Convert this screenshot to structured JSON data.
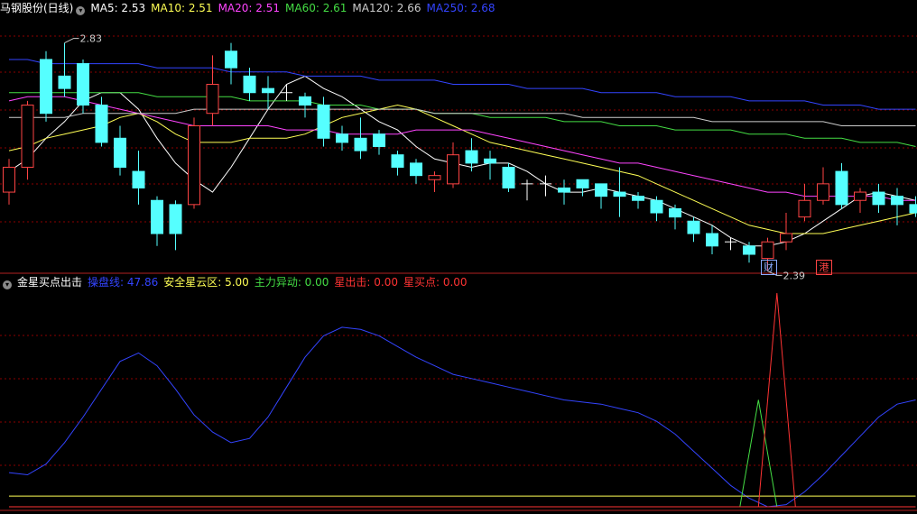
{
  "main_panel": {
    "title": "马钢股份(日线)",
    "indicators": [
      {
        "label": "MA5: 2.53",
        "color": "#ffffff"
      },
      {
        "label": "MA10: 2.51",
        "color": "#ffff55"
      },
      {
        "label": "MA20: 2.51",
        "color": "#ff44ff"
      },
      {
        "label": "MA60: 2.61",
        "color": "#44dd44"
      },
      {
        "label": "MA120: 2.66",
        "color": "#cccccc"
      },
      {
        "label": "MA250: 2.68",
        "color": "#3344ff"
      }
    ],
    "high_marker": "2.83",
    "low_marker": "2.39",
    "events": [
      {
        "label": "财",
        "color": "#88aaff",
        "index": 41
      },
      {
        "label": "港",
        "color": "#ff4444",
        "index": 44
      }
    ]
  },
  "indicator_panel": {
    "title": "金星买点出击",
    "values": [
      {
        "label": "操盘线: 47.86",
        "color": "#3344ff"
      },
      {
        "label": "安全星云区: 5.00",
        "color": "#ffff55"
      },
      {
        "label": "主力异动: 0.00",
        "color": "#44dd44"
      },
      {
        "label": "星出击: 0.00",
        "color": "#ff3333"
      },
      {
        "label": "星买点: 0.00",
        "color": "#ff3333"
      }
    ]
  },
  "colors": {
    "up_candle": "#ff4444",
    "down_candle": "#55ffff",
    "grid": "#8b0000",
    "separator": "#b22222"
  },
  "chart_data": [
    {
      "type": "candlestick",
      "name": "马钢股份(日线)",
      "ylim": [
        2.35,
        2.92
      ],
      "candles": [
        [
          2.5,
          2.56,
          2.47,
          2.58
        ],
        [
          2.56,
          2.71,
          2.53,
          2.72
        ],
        [
          2.82,
          2.69,
          2.67,
          2.84
        ],
        [
          2.78,
          2.75,
          2.73,
          2.86
        ],
        [
          2.81,
          2.71,
          2.69,
          2.82
        ],
        [
          2.71,
          2.62,
          2.61,
          2.73
        ],
        [
          2.63,
          2.56,
          2.54,
          2.66
        ],
        [
          2.55,
          2.51,
          2.47,
          2.6
        ],
        [
          2.48,
          2.4,
          2.37,
          2.49
        ],
        [
          2.47,
          2.4,
          2.36,
          2.48
        ],
        [
          2.47,
          2.66,
          2.46,
          2.68
        ],
        [
          2.69,
          2.76,
          2.66,
          2.83
        ],
        [
          2.84,
          2.8,
          2.76,
          2.86
        ],
        [
          2.78,
          2.74,
          2.72,
          2.8
        ],
        [
          2.75,
          2.74,
          2.7,
          2.78
        ],
        [
          2.74,
          2.74,
          2.72,
          2.76
        ],
        [
          2.73,
          2.71,
          2.68,
          2.74
        ],
        [
          2.71,
          2.63,
          2.61,
          2.73
        ],
        [
          2.64,
          2.62,
          2.6,
          2.66
        ],
        [
          2.63,
          2.6,
          2.58,
          2.68
        ],
        [
          2.64,
          2.61,
          2.59,
          2.65
        ],
        [
          2.59,
          2.56,
          2.54,
          2.6
        ],
        [
          2.57,
          2.54,
          2.52,
          2.58
        ],
        [
          2.53,
          2.54,
          2.5,
          2.55
        ],
        [
          2.52,
          2.59,
          2.51,
          2.62
        ],
        [
          2.6,
          2.57,
          2.55,
          2.63
        ],
        [
          2.58,
          2.57,
          2.53,
          2.6
        ],
        [
          2.56,
          2.51,
          2.5,
          2.57
        ],
        [
          2.52,
          2.52,
          2.48,
          2.53
        ],
        [
          2.52,
          2.52,
          2.49,
          2.54
        ],
        [
          2.51,
          2.5,
          2.47,
          2.53
        ],
        [
          2.53,
          2.51,
          2.49,
          2.53
        ],
        [
          2.52,
          2.49,
          2.46,
          2.52
        ],
        [
          2.5,
          2.49,
          2.44,
          2.56
        ],
        [
          2.49,
          2.48,
          2.46,
          2.5
        ],
        [
          2.48,
          2.45,
          2.43,
          2.49
        ],
        [
          2.46,
          2.44,
          2.41,
          2.47
        ],
        [
          2.43,
          2.4,
          2.38,
          2.44
        ],
        [
          2.4,
          2.37,
          2.35,
          2.42
        ],
        [
          2.38,
          2.38,
          2.36,
          2.39
        ],
        [
          2.37,
          2.35,
          2.33,
          2.38
        ],
        [
          2.34,
          2.38,
          2.31,
          2.39
        ],
        [
          2.38,
          2.4,
          2.36,
          2.45
        ],
        [
          2.44,
          2.48,
          2.43,
          2.52
        ],
        [
          2.48,
          2.52,
          2.47,
          2.56
        ],
        [
          2.55,
          2.47,
          2.46,
          2.57
        ],
        [
          2.48,
          2.5,
          2.45,
          2.51
        ],
        [
          2.5,
          2.47,
          2.45,
          2.52
        ],
        [
          2.49,
          2.47,
          2.42,
          2.51
        ],
        [
          2.47,
          2.45,
          2.44,
          2.49
        ]
      ],
      "series": [
        {
          "name": "MA5",
          "values": [
            2.55,
            2.58,
            2.63,
            2.67,
            2.72,
            2.74,
            2.74,
            2.7,
            2.63,
            2.57,
            2.53,
            2.5,
            2.56,
            2.63,
            2.7,
            2.76,
            2.78,
            2.75,
            2.73,
            2.7,
            2.67,
            2.65,
            2.61,
            2.58,
            2.57,
            2.56,
            2.57,
            2.57,
            2.55,
            2.52,
            2.5,
            2.5,
            2.51,
            2.5,
            2.49,
            2.48,
            2.46,
            2.44,
            2.42,
            2.39,
            2.37,
            2.37,
            2.38,
            2.4,
            2.43,
            2.46,
            2.49,
            2.5,
            2.49,
            2.48
          ]
        },
        {
          "name": "MA10",
          "values": [
            2.6,
            2.61,
            2.63,
            2.64,
            2.65,
            2.66,
            2.68,
            2.69,
            2.67,
            2.64,
            2.62,
            2.62,
            2.62,
            2.63,
            2.63,
            2.63,
            2.64,
            2.66,
            2.68,
            2.69,
            2.7,
            2.71,
            2.7,
            2.68,
            2.66,
            2.64,
            2.62,
            2.61,
            2.6,
            2.59,
            2.58,
            2.57,
            2.56,
            2.55,
            2.54,
            2.52,
            2.5,
            2.48,
            2.46,
            2.44,
            2.42,
            2.41,
            2.4,
            2.4,
            2.4,
            2.41,
            2.42,
            2.43,
            2.44,
            2.45
          ]
        },
        {
          "name": "MA20",
          "values": [
            2.72,
            2.73,
            2.73,
            2.73,
            2.72,
            2.71,
            2.7,
            2.69,
            2.68,
            2.67,
            2.66,
            2.66,
            2.66,
            2.66,
            2.66,
            2.65,
            2.65,
            2.65,
            2.64,
            2.64,
            2.64,
            2.64,
            2.65,
            2.65,
            2.65,
            2.65,
            2.64,
            2.63,
            2.62,
            2.61,
            2.6,
            2.59,
            2.58,
            2.57,
            2.57,
            2.56,
            2.55,
            2.54,
            2.53,
            2.52,
            2.51,
            2.5,
            2.5,
            2.49,
            2.49,
            2.49,
            2.49,
            2.49,
            2.48,
            2.48
          ]
        },
        {
          "name": "MA60",
          "values": [
            2.74,
            2.74,
            2.74,
            2.74,
            2.74,
            2.74,
            2.74,
            2.74,
            2.73,
            2.73,
            2.73,
            2.73,
            2.73,
            2.72,
            2.72,
            2.72,
            2.72,
            2.71,
            2.71,
            2.71,
            2.7,
            2.7,
            2.7,
            2.69,
            2.69,
            2.69,
            2.68,
            2.68,
            2.68,
            2.68,
            2.67,
            2.67,
            2.67,
            2.66,
            2.66,
            2.66,
            2.65,
            2.65,
            2.65,
            2.65,
            2.64,
            2.64,
            2.64,
            2.63,
            2.63,
            2.63,
            2.62,
            2.62,
            2.62,
            2.61
          ]
        },
        {
          "name": "MA120",
          "values": [
            2.68,
            2.68,
            2.68,
            2.68,
            2.69,
            2.69,
            2.69,
            2.69,
            2.69,
            2.69,
            2.7,
            2.7,
            2.7,
            2.7,
            2.7,
            2.7,
            2.7,
            2.7,
            2.7,
            2.7,
            2.7,
            2.7,
            2.7,
            2.69,
            2.69,
            2.69,
            2.69,
            2.69,
            2.69,
            2.69,
            2.69,
            2.68,
            2.68,
            2.68,
            2.68,
            2.68,
            2.68,
            2.68,
            2.67,
            2.67,
            2.67,
            2.67,
            2.67,
            2.67,
            2.67,
            2.66,
            2.66,
            2.66,
            2.66,
            2.66
          ]
        },
        {
          "name": "MA250",
          "values": [
            2.82,
            2.82,
            2.81,
            2.81,
            2.81,
            2.81,
            2.81,
            2.81,
            2.8,
            2.8,
            2.8,
            2.8,
            2.79,
            2.79,
            2.79,
            2.79,
            2.78,
            2.78,
            2.78,
            2.78,
            2.77,
            2.77,
            2.77,
            2.77,
            2.76,
            2.76,
            2.76,
            2.76,
            2.75,
            2.75,
            2.75,
            2.75,
            2.74,
            2.74,
            2.74,
            2.74,
            2.73,
            2.73,
            2.73,
            2.73,
            2.72,
            2.72,
            2.72,
            2.72,
            2.71,
            2.71,
            2.71,
            2.7,
            2.7,
            2.7
          ]
        }
      ]
    },
    {
      "type": "line",
      "name": "金星买点出击",
      "ylim": [
        0,
        100
      ],
      "series": [
        {
          "name": "操盘线",
          "values": [
            16,
            15,
            20,
            30,
            42,
            55,
            68,
            72,
            66,
            55,
            43,
            35,
            30,
            32,
            42,
            56,
            70,
            80,
            84,
            83,
            80,
            75,
            70,
            66,
            62,
            60,
            58,
            56,
            54,
            52,
            50,
            49,
            48,
            46,
            44,
            40,
            34,
            26,
            18,
            10,
            4,
            0,
            1,
            7,
            15,
            24,
            33,
            42,
            48,
            50
          ]
        },
        {
          "name": "安全星云区",
          "values": [
            5,
            5,
            5,
            5,
            5,
            5,
            5,
            5,
            5,
            5,
            5,
            5,
            5,
            5,
            5,
            5,
            5,
            5,
            5,
            5,
            5,
            5,
            5,
            5,
            5,
            5,
            5,
            5,
            5,
            5,
            5,
            5,
            5,
            5,
            5,
            5,
            5,
            5,
            5,
            5,
            5,
            5,
            5,
            5,
            5,
            5,
            5,
            5,
            5,
            5
          ]
        },
        {
          "name": "主力异动",
          "points": [
            [
              39.5,
              0
            ],
            [
              40.5,
              50
            ],
            [
              41.5,
              0
            ]
          ]
        },
        {
          "name": "星出击",
          "points": [
            [
              40.5,
              0
            ],
            [
              41.5,
              100
            ],
            [
              42.5,
              0
            ]
          ]
        },
        {
          "name": "星买点",
          "values": [
            0,
            0,
            0,
            0,
            0,
            0,
            0,
            0,
            0,
            0,
            0,
            0,
            0,
            0,
            0,
            0,
            0,
            0,
            0,
            0,
            0,
            0,
            0,
            0,
            0,
            0,
            0,
            0,
            0,
            0,
            0,
            0,
            0,
            0,
            0,
            0,
            0,
            0,
            0,
            0,
            0,
            0,
            0,
            0,
            0,
            0,
            0,
            0,
            0,
            0
          ]
        }
      ]
    }
  ]
}
